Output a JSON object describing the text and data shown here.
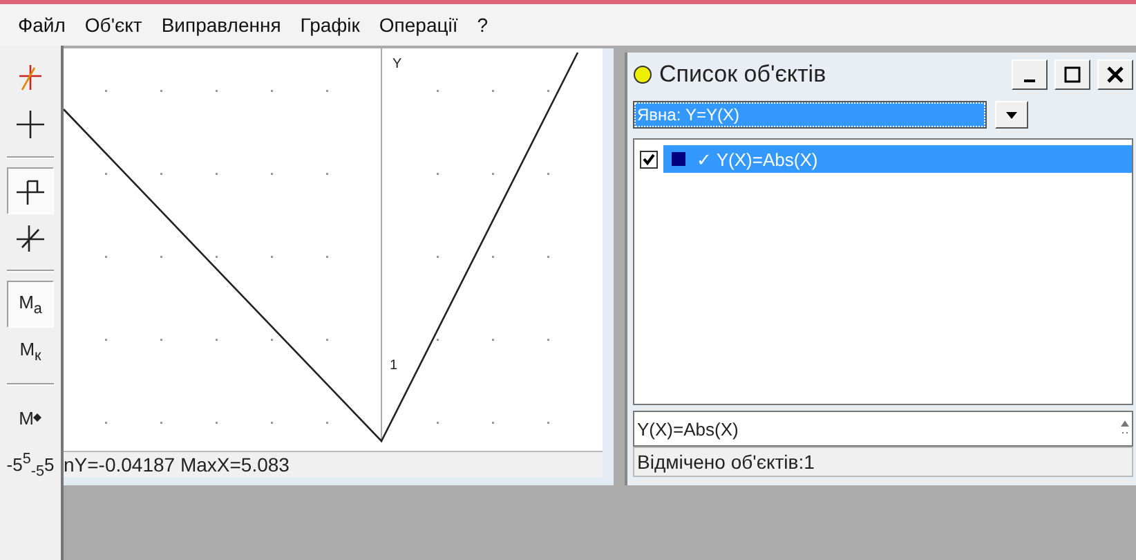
{
  "menu": [
    {
      "label": "Файл"
    },
    {
      "label": "Об'єкт"
    },
    {
      "label": "Виправлення"
    },
    {
      "label": "Графік"
    },
    {
      "label": "Операції"
    },
    {
      "label": "?"
    }
  ],
  "toolbar": [
    {
      "kind": "cross_pen",
      "pressed": false
    },
    {
      "kind": "cross",
      "pressed": false
    },
    {
      "kind": "cross_flag",
      "pressed": true,
      "divider_before": true
    },
    {
      "kind": "cross_slash",
      "pressed": false
    },
    {
      "kind": "text",
      "label": "M$_{a}$",
      "pressed": true,
      "divider_before": true
    },
    {
      "kind": "text",
      "label": "M$_{к}$",
      "pressed": false
    },
    {
      "kind": "marker",
      "label": "M",
      "pressed": false,
      "divider_before": true
    },
    {
      "kind": "text",
      "label": "-5$^{5}$$_{-5}$5",
      "pressed": false
    }
  ],
  "graph": {
    "axis_label": "Y",
    "tick_label": "1",
    "status": "nY=-0.04187  MaxX=5.083"
  },
  "object_list": {
    "title": "Список об'єктів",
    "filter": "Явна: Y=Y(X)",
    "items": [
      {
        "label": "✓ Y(X)=Abs(X)",
        "checked": true,
        "selected": true,
        "color": "#000080"
      }
    ],
    "formula": "Y(X)=Abs(X)",
    "status": "Відмічено об'єктів:1"
  }
}
